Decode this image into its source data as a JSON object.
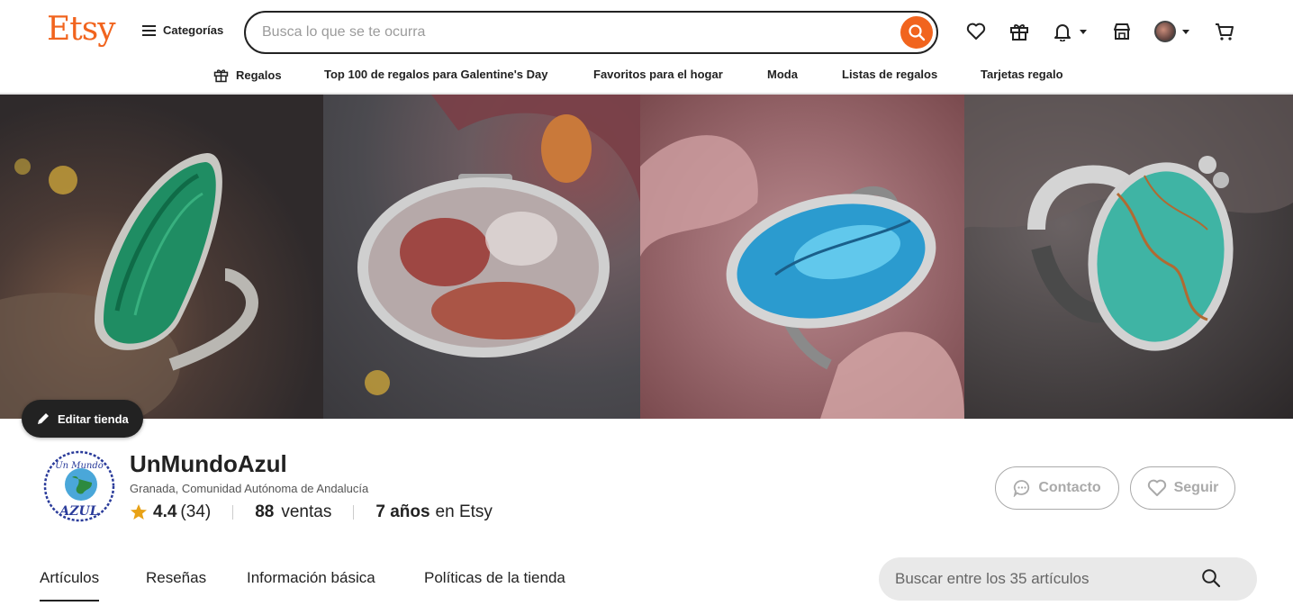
{
  "header": {
    "logo": "Etsy",
    "categories_label": "Categorías",
    "search_placeholder": "Busca lo que se te ocurra"
  },
  "subnav": [
    {
      "label": "Regalos"
    },
    {
      "label": "Top 100 de regalos para Galentine's Day"
    },
    {
      "label": "Favoritos para el hogar"
    },
    {
      "label": "Moda"
    },
    {
      "label": "Listas de regalos"
    },
    {
      "label": "Tarjetas regalo"
    }
  ],
  "banner": {
    "edit_label": "Editar tienda"
  },
  "shop": {
    "name": "UnMundoAzul",
    "location": "Granada, Comunidad Autónoma de Andalucía",
    "rating": "4.4",
    "reviews": "(34)",
    "sales_count": "88",
    "sales_label": "ventas",
    "years": "7 años",
    "years_suffix": "en Etsy",
    "logo_text_top": "Un Mundo",
    "logo_text_bottom": "AZUL",
    "contact_label": "Contacto",
    "follow_label": "Seguir"
  },
  "tabs": [
    {
      "label": "Artículos",
      "active": true
    },
    {
      "label": "Reseñas"
    },
    {
      "label": "Información básica"
    },
    {
      "label": "Políticas de la tienda"
    }
  ],
  "shop_search": {
    "placeholder": "Buscar entre los 35 artículos"
  },
  "colors": {
    "brand": "#f1641e",
    "text": "#222222",
    "star": "#e8a217"
  }
}
